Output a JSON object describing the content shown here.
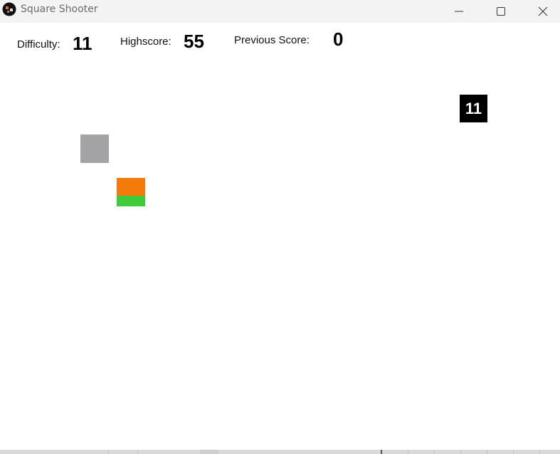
{
  "window": {
    "title": "Square Shooter",
    "icons": {
      "app": "game-app-icon",
      "minimize": "minimize-icon",
      "maximize": "maximize-icon",
      "close": "close-icon"
    }
  },
  "hud": {
    "difficulty_label": "Difficulty:",
    "difficulty_value": "11",
    "highscore_label": "Highscore:",
    "highscore_value": "55",
    "previous_score_label": "Previous Score:",
    "previous_score_value": "0"
  },
  "entities": {
    "enemy_label": "11"
  },
  "colors": {
    "background": "#ffffff",
    "titlebar": "#f3f3f3",
    "gray_square": "#a3a3a6",
    "player_top": "#f47a0a",
    "player_bottom": "#3fcc3a",
    "enemy": "#000000"
  }
}
